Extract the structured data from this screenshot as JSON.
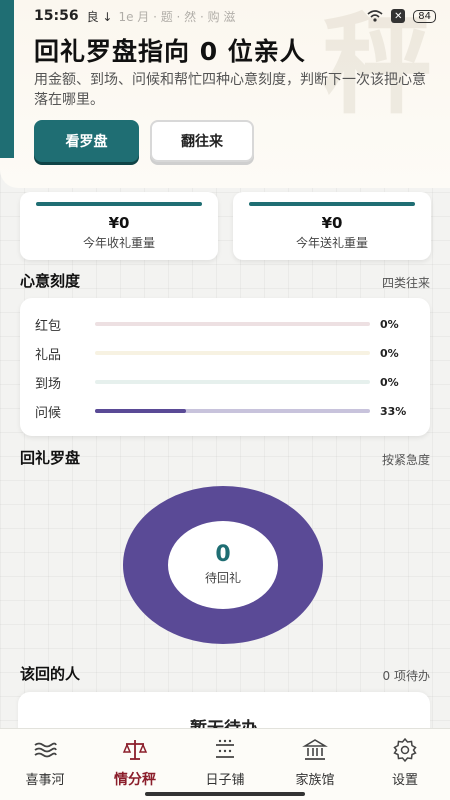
{
  "status_bar": {
    "time": "15:56",
    "mini_icons": "良 ↓",
    "ghost_text": "1e   月 · 题 · 然 · 购 滋",
    "battery": "84"
  },
  "hero": {
    "watermark": "秤",
    "title": "回礼罗盘指向 0 位亲人",
    "subtitle": "用金额、到场、问候和帮忙四种心意刻度，判断下一次该把心意落在哪里。",
    "primary_button": "看罗盘",
    "secondary_button": "翻往来"
  },
  "stats": [
    {
      "value": "¥0",
      "label": "今年收礼重量"
    },
    {
      "value": "¥0",
      "label": "今年送礼重量"
    }
  ],
  "intent": {
    "title": "心意刻度",
    "hint": "四类往来",
    "rows": [
      {
        "label": "红包",
        "pct": "0%",
        "value": 0,
        "color": "#c9a3a8"
      },
      {
        "label": "礼品",
        "pct": "0%",
        "value": 0,
        "color": "#e8d9a8"
      },
      {
        "label": "到场",
        "pct": "0%",
        "value": 0,
        "color": "#b5d2c8"
      },
      {
        "label": "问候",
        "pct": "33%",
        "value": 0.33,
        "color": "#5a4a96"
      }
    ]
  },
  "compass": {
    "title": "回礼罗盘",
    "hint": "按紧急度",
    "count": "0",
    "count_label": "待回礼",
    "ring_color": "#5a4a96"
  },
  "pending": {
    "title": "该回的人",
    "hint": "0 项待办",
    "empty_text": "暂无待办"
  },
  "tabs": [
    {
      "label": "喜事河",
      "icon": "waves-icon"
    },
    {
      "label": "情分秤",
      "icon": "scale-icon"
    },
    {
      "label": "日子铺",
      "icon": "calendar-dots-icon"
    },
    {
      "label": "家族馆",
      "icon": "museum-icon"
    },
    {
      "label": "设置",
      "icon": "gear-icon"
    }
  ],
  "active_tab": "情分秤",
  "colors": {
    "accent": "#1f6e73",
    "active_tab": "#8b1e2b",
    "donut": "#5a4a96"
  }
}
